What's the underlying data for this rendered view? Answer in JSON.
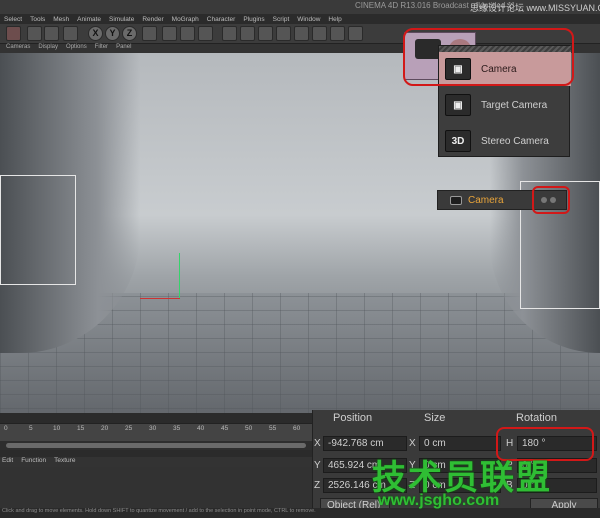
{
  "window": {
    "title": "CINEMA 4D R13.016 Broadcast - [Untitled 1]",
    "watermark_top": "思缘设计论坛 www.MISSYUAN.COM"
  },
  "menu": [
    "Select",
    "Tools",
    "Mesh",
    "Animate",
    "Simulate",
    "Render",
    "MoGraph",
    "Character",
    "Plugins",
    "Script",
    "Window",
    "Help"
  ],
  "sub_menu": [
    "Cameras",
    "Display",
    "Options",
    "Filter",
    "Panel"
  ],
  "toolbar": {
    "axis_labels": [
      "X",
      "Y",
      "Z"
    ]
  },
  "camera_menu": {
    "items": [
      {
        "label": "Camera",
        "icon": "camera-icon",
        "selected": true
      },
      {
        "label": "Target Camera",
        "icon": "target-camera-icon"
      },
      {
        "label": "Stereo Camera",
        "icon": "stereo-camera-icon",
        "badge": "3D"
      }
    ]
  },
  "object_tag": {
    "label": "Camera"
  },
  "timeline": {
    "ticks": [
      "0",
      "5",
      "10",
      "15",
      "20",
      "25",
      "30",
      "35",
      "40",
      "45",
      "50",
      "55",
      "60"
    ]
  },
  "material_menu": [
    "Edit",
    "Function",
    "Texture"
  ],
  "coordinates": {
    "headers": {
      "position": "Position",
      "size": "Size",
      "rotation": "Rotation"
    },
    "rows": [
      {
        "axis": "X",
        "position": "-942.768 cm",
        "size_axis": "X",
        "size": "0 cm",
        "rot_axis": "H",
        "rotation": "180 °"
      },
      {
        "axis": "Y",
        "position": "465.924 cm",
        "size_axis": "Y",
        "size": "0 cm",
        "rot_axis": "P",
        "rotation": "0 °"
      },
      {
        "axis": "Z",
        "position": "2526.146 cm",
        "size_axis": "Z",
        "size": "0 cm",
        "rot_axis": "B",
        "rotation": "0 °"
      }
    ],
    "object_select": "Object (Rel)",
    "apply": "Apply"
  },
  "status": "Click and drag to move elements. Hold down SHIFT to quantize movement / add to the selection in point mode, CTRL to remove.",
  "watermark": {
    "text": "技术员联盟",
    "url": "www.jsgho.com"
  },
  "colors": {
    "highlight": "#d21818",
    "selected_item": "#c89a9b",
    "tag_label": "#e8a43a",
    "watermark": "#2fbe34"
  }
}
